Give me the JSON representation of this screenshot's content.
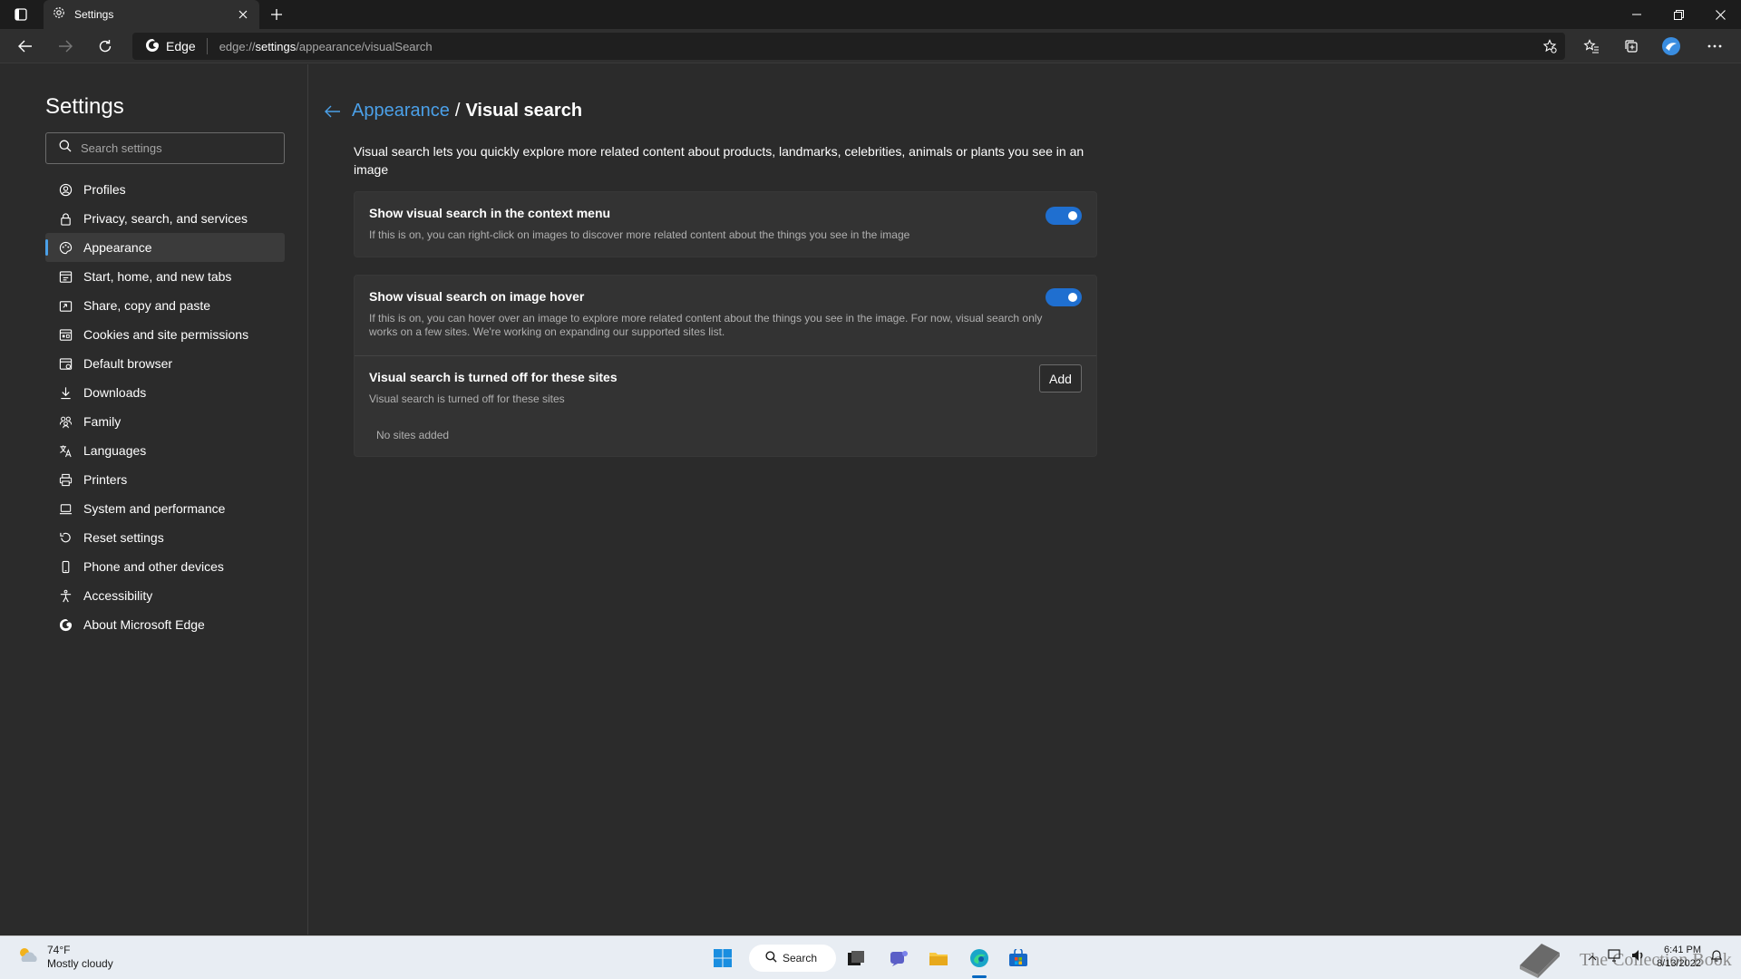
{
  "browser": {
    "tab_title": "Settings",
    "address_chip": "Edge",
    "url_prefix": "edge://",
    "url_host": "settings",
    "url_path": "/appearance/visualSearch"
  },
  "sidebar": {
    "title": "Settings",
    "search_placeholder": "Search settings",
    "items": [
      {
        "label": "Profiles",
        "icon": "profile-icon"
      },
      {
        "label": "Privacy, search, and services",
        "icon": "lock-icon"
      },
      {
        "label": "Appearance",
        "icon": "palette-icon",
        "active": true
      },
      {
        "label": "Start, home, and new tabs",
        "icon": "home-tab-icon"
      },
      {
        "label": "Share, copy and paste",
        "icon": "share-icon"
      },
      {
        "label": "Cookies and site permissions",
        "icon": "cookies-icon"
      },
      {
        "label": "Default browser",
        "icon": "browser-icon"
      },
      {
        "label": "Downloads",
        "icon": "download-icon"
      },
      {
        "label": "Family",
        "icon": "family-icon"
      },
      {
        "label": "Languages",
        "icon": "language-icon"
      },
      {
        "label": "Printers",
        "icon": "printer-icon"
      },
      {
        "label": "System and performance",
        "icon": "laptop-icon"
      },
      {
        "label": "Reset settings",
        "icon": "reset-icon"
      },
      {
        "label": "Phone and other devices",
        "icon": "phone-icon"
      },
      {
        "label": "Accessibility",
        "icon": "accessibility-icon"
      },
      {
        "label": "About Microsoft Edge",
        "icon": "edge-logo-icon"
      }
    ]
  },
  "main": {
    "breadcrumb_parent": "Appearance",
    "breadcrumb_sep": "/",
    "breadcrumb_current": "Visual search",
    "intro": "Visual search lets you quickly explore more related content about products, landmarks, celebrities, animals or plants you see in an image",
    "context_menu": {
      "title": "Show visual search in the context menu",
      "desc": "If this is on, you can right-click on images to discover more related content about the things you see in the image",
      "enabled": true
    },
    "hover": {
      "title": "Show visual search on image hover",
      "desc": "If this is on, you can hover over an image to explore more related content about the things you see in the image. For now, visual search only works on a few sites. We're working on expanding our supported sites list.",
      "enabled": true
    },
    "blocked_sites": {
      "title": "Visual search is turned off for these sites",
      "desc": "Visual search is turned off for these sites",
      "add_label": "Add",
      "empty_text": "No sites added"
    }
  },
  "taskbar": {
    "weather_temp": "74°F",
    "weather_desc": "Mostly cloudy",
    "search_label": "Search",
    "time": "6:41 PM",
    "date": "8/13/2022",
    "watermark": "The Collection Book"
  },
  "colors": {
    "accent": "#4ba0e8",
    "toggle_on": "#1f6fd0",
    "background": "#2b2b2b",
    "card": "#333333"
  }
}
